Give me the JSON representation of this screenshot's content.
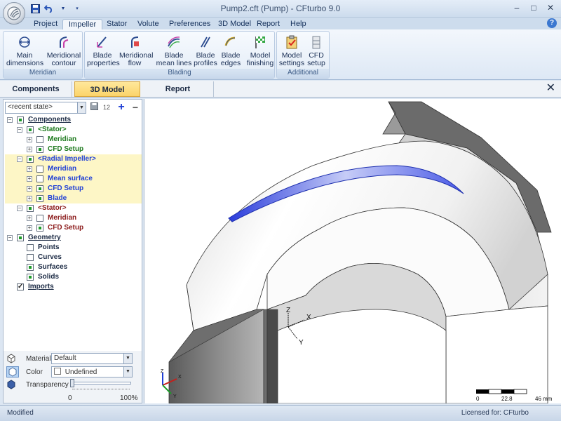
{
  "window": {
    "title": "Pump2.cft (Pump) - CFturbo 9.0"
  },
  "ribbon_tabs": [
    "Project",
    "Impeller",
    "Stator",
    "Volute",
    "Preferences",
    "3D Model",
    "Report",
    "Help"
  ],
  "ribbon_groups": {
    "meridian": {
      "label": "Meridian",
      "buttons": [
        {
          "line1": "Main",
          "line2": "dimensions"
        },
        {
          "line1": "Meridional",
          "line2": "contour"
        }
      ]
    },
    "blading": {
      "label": "Blading",
      "buttons": [
        {
          "line1": "Blade",
          "line2": "properties"
        },
        {
          "line1": "Meridional",
          "line2": "flow"
        },
        {
          "line1": "Blade",
          "line2": "mean lines"
        },
        {
          "line1": "Blade",
          "line2": "profiles"
        },
        {
          "line1": "Blade",
          "line2": "edges"
        },
        {
          "line1": "Model",
          "line2": "finishing"
        }
      ]
    },
    "additional": {
      "label": "Additional",
      "buttons": [
        {
          "line1": "Model",
          "line2": "settings"
        },
        {
          "line1": "CFD",
          "line2": "setup"
        }
      ]
    }
  },
  "view_tabs": [
    "Components",
    "3D Model",
    "Report"
  ],
  "toolbar": {
    "state_combo": "<recent state>",
    "sort_label": "12"
  },
  "tree": [
    {
      "label": "Components",
      "color": "#1b2a44"
    },
    {
      "label": "<Stator>",
      "color": "#1e7a1e"
    },
    {
      "label": "Meridian",
      "color": "#1e7a1e"
    },
    {
      "label": "CFD Setup",
      "color": "#1e7a1e"
    },
    {
      "label": "<Radial Impeller>",
      "color": "#1f3fd6"
    },
    {
      "label": "Meridian",
      "color": "#1f3fd6"
    },
    {
      "label": "Mean surface",
      "color": "#1f3fd6"
    },
    {
      "label": "CFD Setup",
      "color": "#1f3fd6"
    },
    {
      "label": "Blade",
      "color": "#1f3fd6"
    },
    {
      "label": "<Stator>",
      "color": "#8b1a1a"
    },
    {
      "label": "Meridian",
      "color": "#8b1a1a"
    },
    {
      "label": "CFD Setup",
      "color": "#8b1a1a"
    },
    {
      "label": "Geometry",
      "color": "#1b2a44"
    },
    {
      "label": "Points",
      "color": "#1b2a44"
    },
    {
      "label": "Curves",
      "color": "#1b2a44"
    },
    {
      "label": "Surfaces",
      "color": "#1b2a44"
    },
    {
      "label": "Solids",
      "color": "#1b2a44"
    },
    {
      "label": "Imports",
      "color": "#1b2a44"
    }
  ],
  "material": {
    "material_label": "Material",
    "material_value": "Default",
    "color_label": "Color",
    "color_value": "Undefined",
    "transparency_label": "Transparency",
    "transparency_min": "0",
    "transparency_max": "100%"
  },
  "viewport": {
    "axes_large": {
      "z": "Z",
      "x": "X",
      "y": "Y"
    },
    "axes_small": {
      "z": "Z",
      "x": "X",
      "y": "Y"
    },
    "scale": {
      "start": "0",
      "mid": "22.8",
      "end": "46 mm"
    }
  },
  "status": {
    "left": "Modified",
    "right": "Licensed for: CFturbo"
  },
  "colors": {
    "blade": "#3b4fe0",
    "hub": "#d4d4d4",
    "accent_tab": "#fbd46a"
  }
}
